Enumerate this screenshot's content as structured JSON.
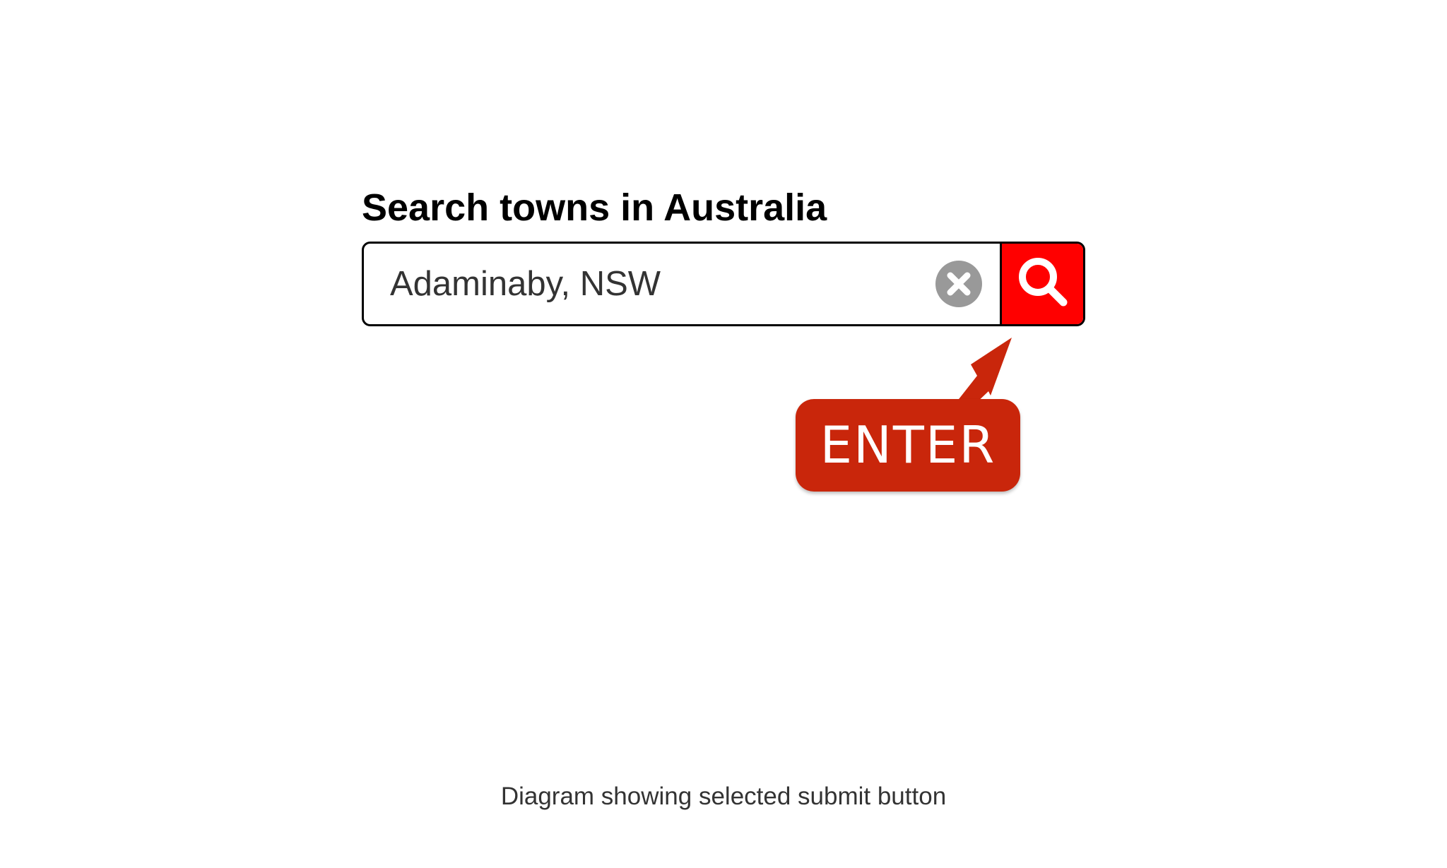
{
  "search": {
    "label": "Search towns in Australia",
    "value": "Adaminaby, NSW",
    "clear_icon": "close-circle-icon",
    "submit_icon": "search-icon"
  },
  "annotation": {
    "key_label": "ENTER",
    "arrow_icon": "arrow-up-right-icon"
  },
  "caption": "Diagram showing selected submit button",
  "colors": {
    "submit_background": "#ff0000",
    "enter_key_background": "#c9260b",
    "clear_icon": "#999999"
  }
}
